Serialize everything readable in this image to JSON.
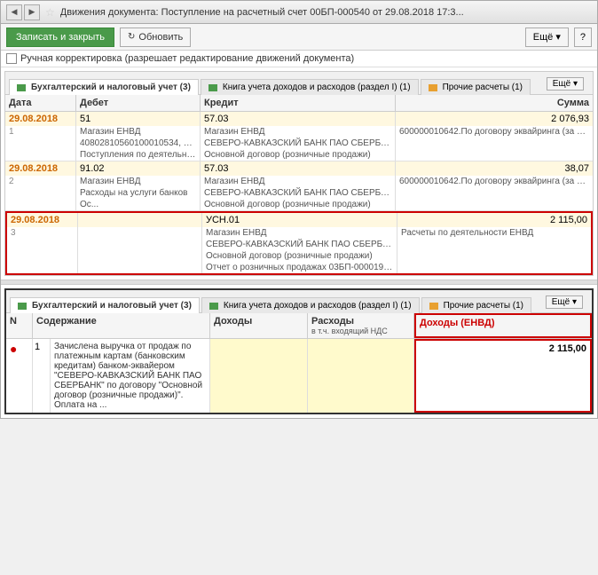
{
  "window": {
    "title": "Движения документа: Поступление на расчетный счет 00БП-000540 от 29.08.2018 17:3...",
    "toolbar": {
      "save_close": "Записать и закрыть",
      "refresh": "Обновить",
      "more": "Ещё ▾",
      "help": "?"
    },
    "manual_correction": "Ручная корректировка (разрешает редактирование движений документа)"
  },
  "section1": {
    "tabs": [
      {
        "label": "Бухгалтерский и налоговый учет (3)",
        "active": true,
        "icon": "green"
      },
      {
        "label": "Книга учета доходов и расходов (раздел I) (1)",
        "active": false,
        "icon": "green"
      },
      {
        "label": "Прочие расчеты (1)",
        "active": false,
        "icon": "orange"
      }
    ],
    "esche": "Ещё ▾",
    "columns": {
      "date": "Дата",
      "debet": "Дебет",
      "kredit": "Кредит",
      "summa": "Сумма"
    },
    "rows": [
      {
        "date": "29.08.2018",
        "num": "",
        "debet": "51",
        "kredit": "57.03",
        "summa": "2 076,93",
        "highlighted": false,
        "sub": [
          {
            "num": "1",
            "debet": "Магазин ЕНВД",
            "kredit": "Магазин ЕНВД",
            "summa": "600000010642.По договору эквайринга (за 28.08.2018;сумма ..."
          },
          {
            "num": "",
            "debet": "40802810560100010534, СЕВЕРО-КАВКАЗСКИ...",
            "kredit": "СЕВЕРО-КАВКАЗСКИЙ БАНК ПАО СБЕРБАНК",
            "summa": ""
          },
          {
            "num": "",
            "debet": "Поступления по деятельности (эквайринг) ЕНВД",
            "kredit": "Основной договор (розничные продажи)",
            "summa": ""
          }
        ]
      },
      {
        "date": "29.08.2018",
        "num": "",
        "debet": "91.02",
        "kredit": "57.03",
        "summa": "38,07",
        "highlighted": false,
        "sub": [
          {
            "num": "2",
            "debet": "Магазин ЕНВД",
            "kredit": "Магазин ЕНВД",
            "summa": "600000010642.По договору эквайринга (за 28.08.2018;сумма ..."
          },
          {
            "num": "",
            "debet": "Расходы на услуги банков",
            "kredit": "СЕВЕРО-КАВКАЗСКИЙ БАНК ПАО СБЕРБАНК",
            "summa": ""
          },
          {
            "num": "",
            "debet": "Ос...",
            "kredit": "Основной договор (розничные продажи)",
            "summa": ""
          }
        ]
      },
      {
        "date": "29.08.2018",
        "num": "",
        "debet": "",
        "kredit": "УСН.01",
        "summa": "2 115,00",
        "highlighted": true,
        "sub": [
          {
            "num": "3",
            "debet": "",
            "kredit": "Магазин ЕНВД",
            "summa": "Расчеты по деятельности ЕНВД"
          },
          {
            "num": "",
            "debet": "",
            "kredit": "СЕВЕРО-КАВКАЗСКИЙ БАНК ПАО СБЕРБАНК",
            "summa": ""
          },
          {
            "num": "",
            "debet": "",
            "kredit": "Основной договор (розничные продажи)",
            "summa": ""
          },
          {
            "num": "",
            "debet": "",
            "kredit": "Отчет о розничных продажах 03БП-000019 от 0...",
            "summa": ""
          }
        ]
      }
    ]
  },
  "section2": {
    "tabs": [
      {
        "label": "Бухгалтерский и налоговый учет (3)",
        "icon": "green"
      },
      {
        "label": "Книга учета доходов и расходов (раздел I) (1)",
        "icon": "green"
      },
      {
        "label": "Прочие расчеты (1)",
        "icon": "orange"
      }
    ],
    "esche": "Ещё ▾",
    "columns": {
      "n": "N",
      "content": "Содержание",
      "dohody": "Доходы",
      "rashody": "Расходы",
      "rashody_sub": "в т.ч. входящий НДС",
      "dohody_envd": "Доходы (ЕНВД)"
    },
    "rows": [
      {
        "dot": "●",
        "n": "1",
        "content": "Зачислена выручка от продаж по платежным картам (банковским кредитам) банком-эквайером \"СЕВЕРО-КАВКАЗСКИЙ БАНК ПАО СБЕРБАНК\" по договору \"Основной договор (розничные продажи)\". Оплата на ...",
        "dohody": "",
        "rashody": "",
        "dohody_envd": "2 115,00"
      }
    ]
  }
}
